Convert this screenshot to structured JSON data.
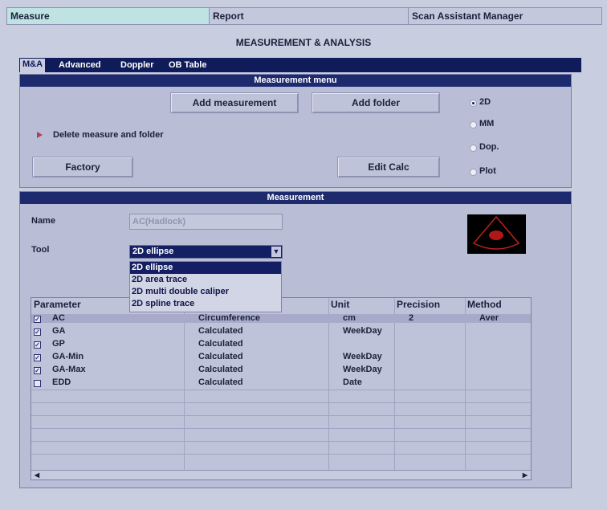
{
  "top_tabs": [
    {
      "label": "Measure",
      "active": true
    },
    {
      "label": "Report",
      "active": false
    },
    {
      "label": "Scan Assistant Manager",
      "active": false
    }
  ],
  "page_title": "MEASUREMENT & ANALYSIS",
  "sub_tabs": [
    {
      "label": "M&A",
      "active": true
    },
    {
      "label": "Advanced",
      "active": false
    },
    {
      "label": "Doppler",
      "active": false
    },
    {
      "label": "OB Table",
      "active": false
    }
  ],
  "measurement_menu": {
    "header": "Measurement menu",
    "add_measurement": "Add measurement",
    "add_folder": "Add folder",
    "delete_label": "Delete measure and folder",
    "factory": "Factory",
    "edit_calc": "Edit Calc",
    "modes": [
      {
        "label": "2D",
        "selected": true
      },
      {
        "label": "MM",
        "selected": false
      },
      {
        "label": "Dop.",
        "selected": false
      },
      {
        "label": "Plot",
        "selected": false
      }
    ]
  },
  "measurement": {
    "header": "Measurement",
    "name_label": "Name",
    "name_value": "AC(Hadlock)",
    "tool_label": "Tool",
    "tool_value": "2D ellipse",
    "tool_options": [
      "2D ellipse",
      "2D area trace",
      "2D multi double caliper",
      "2D spline trace"
    ]
  },
  "table": {
    "columns": [
      "Parameter",
      "",
      "Unit",
      "Precision",
      "Method"
    ],
    "rows": [
      {
        "checked": true,
        "parameter": "AC",
        "type": "Circumference",
        "unit": "cm",
        "precision": "2",
        "method": "Aver"
      },
      {
        "checked": true,
        "parameter": "GA",
        "type": "Calculated",
        "unit": "WeekDay",
        "precision": "",
        "method": ""
      },
      {
        "checked": true,
        "parameter": "GP",
        "type": "Calculated",
        "unit": "",
        "precision": "",
        "method": ""
      },
      {
        "checked": true,
        "parameter": "GA-Min",
        "type": "Calculated",
        "unit": "WeekDay",
        "precision": "",
        "method": ""
      },
      {
        "checked": true,
        "parameter": "GA-Max",
        "type": "Calculated",
        "unit": "WeekDay",
        "precision": "",
        "method": ""
      },
      {
        "checked": false,
        "parameter": "EDD",
        "type": "Calculated",
        "unit": "Date",
        "precision": "",
        "method": ""
      }
    ]
  },
  "colors": {
    "header_bar": "#1d2a6e",
    "active_tab": "#bfe3e3",
    "panel": "#b9bdd6",
    "selection": "#141f63"
  }
}
